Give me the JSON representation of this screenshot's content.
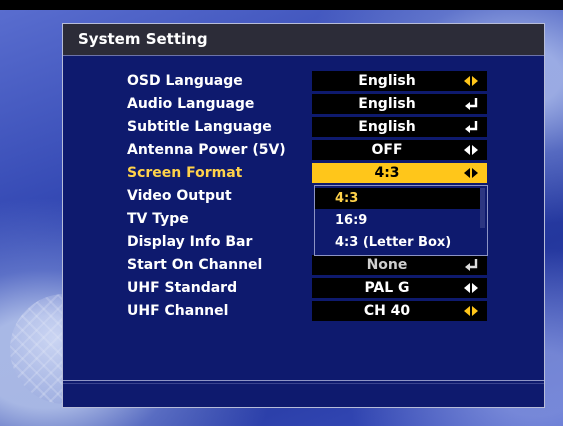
{
  "window": {
    "title": "System Setting"
  },
  "settings": [
    {
      "label": "OSD Language",
      "value": "English",
      "arrow": "left-right-arrows-icon"
    },
    {
      "label": "Audio Language",
      "value": "English",
      "arrow": "enter-icon"
    },
    {
      "label": "Subtitle Language",
      "value": "English",
      "arrow": "enter-icon"
    },
    {
      "label": "Antenna Power (5V)",
      "value": "OFF",
      "arrow": "left-right-arrows-icon"
    },
    {
      "label": "Screen Format",
      "value": "4:3",
      "arrow": "left-right-arrows-icon"
    },
    {
      "label": "Video Output",
      "value": "",
      "arrow": ""
    },
    {
      "label": "TV Type",
      "value": "",
      "arrow": ""
    },
    {
      "label": "Display Info Bar",
      "value": "",
      "arrow": ""
    },
    {
      "label": "Start On Channel",
      "value": "None",
      "arrow": "enter-icon"
    },
    {
      "label": "UHF Standard",
      "value": "PAL G",
      "arrow": "left-right-arrows-icon"
    },
    {
      "label": "UHF Channel",
      "value": "CH 40",
      "arrow": "left-right-arrows-icon"
    }
  ],
  "dropdown": {
    "options": [
      "4:3",
      "16:9",
      "4:3 (Letter Box)"
    ],
    "selected": "4:3"
  },
  "colors": {
    "highlight": "#ffc61a",
    "highlight_text": "#ffd24a",
    "panel": "#0e1a6e",
    "value_bg": "#000000"
  }
}
